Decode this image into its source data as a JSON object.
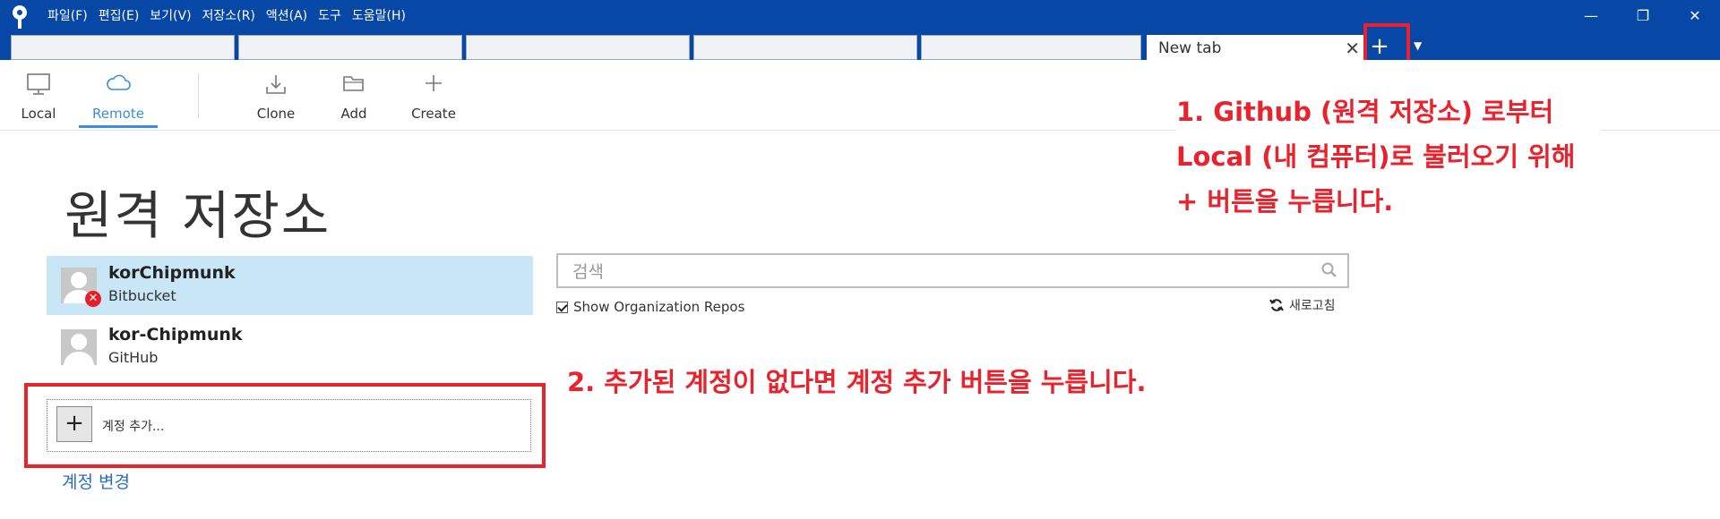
{
  "menu": [
    "파일(F)",
    "편집(E)",
    "보기(V)",
    "저장소(R)",
    "액션(A)",
    "도구",
    "도움말(H)"
  ],
  "window": {
    "minimize": "—",
    "restore": "❐",
    "close": "✕"
  },
  "tabs": {
    "new_tab_label": "New tab",
    "close_glyph": "✕",
    "add_glyph": "+",
    "dropdown_glyph": "▼"
  },
  "toolbar": {
    "local": "Local",
    "remote": "Remote",
    "clone": "Clone",
    "add": "Add",
    "create": "Create"
  },
  "page_title": "원격 저장소",
  "accounts": [
    {
      "name": "korChipmunk",
      "host": "Bitbucket",
      "status": "error",
      "selected": true
    },
    {
      "name": "kor-Chipmunk",
      "host": "GitHub",
      "selected": false
    }
  ],
  "error_glyph": "✕",
  "add_account": {
    "glyph": "+",
    "label": "계정 추가..."
  },
  "change_account": "계정 변경",
  "search": {
    "placeholder": "검색",
    "value": ""
  },
  "show_org_repos": {
    "label": "Show Organization Repos",
    "checked": true
  },
  "refresh_label": "새로고침",
  "annotations": {
    "step1": [
      "1. Github (원격 저장소) 로부터",
      "Local (내 컴퓨터)로 불러오기 위해",
      "+ 버튼을 누릅니다."
    ],
    "step2": "2. 추가된 계정이 없다면 계정 추가 버튼을 누릅니다."
  },
  "colors": {
    "titlebar": "#0747a6",
    "accent": "#3b8fd8",
    "highlight": "#e8232d",
    "selected_row": "#c9e6f7"
  }
}
